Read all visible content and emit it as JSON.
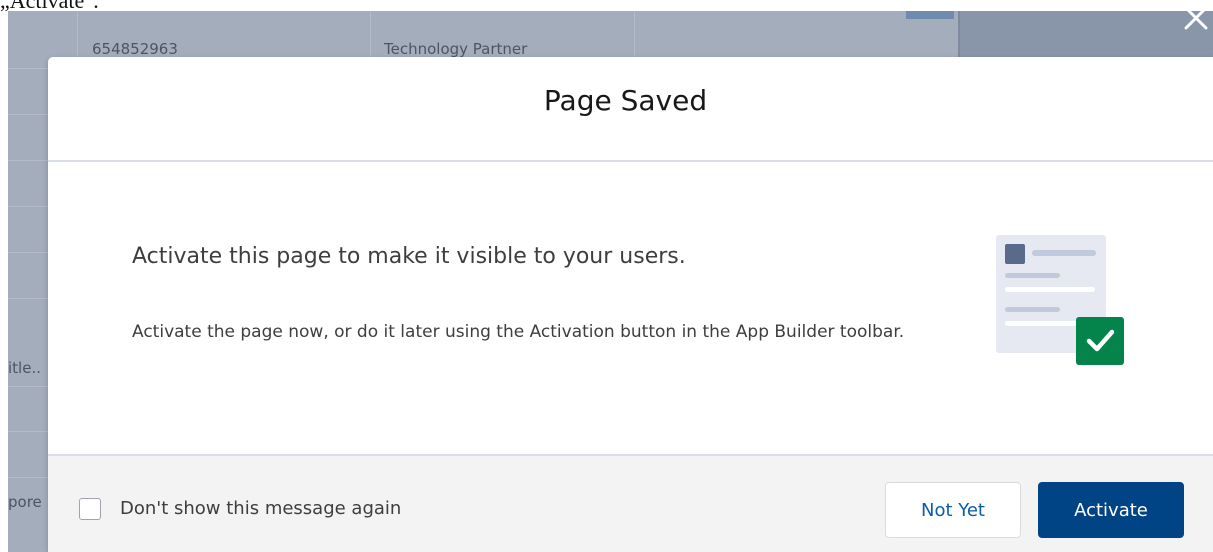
{
  "caption": "„Activate\".",
  "background": {
    "row_cells": [
      "654852963",
      "Technology Partner"
    ],
    "side_fragments": [
      "itle..",
      "pore"
    ]
  },
  "modal": {
    "title": "Page Saved",
    "heading": "Activate this page to make it visible to your users.",
    "description": "Activate the page now, or do it later using the Activation button in the App Builder toolbar.",
    "illustration_icon": "document-checkmark-icon",
    "checkbox_label": "Don't show this message again",
    "not_yet_label": "Not Yet",
    "activate_label": "Activate"
  },
  "colors": {
    "brand_button": "#014486",
    "link_text": "#0b5cab",
    "check_green": "#04844b"
  }
}
